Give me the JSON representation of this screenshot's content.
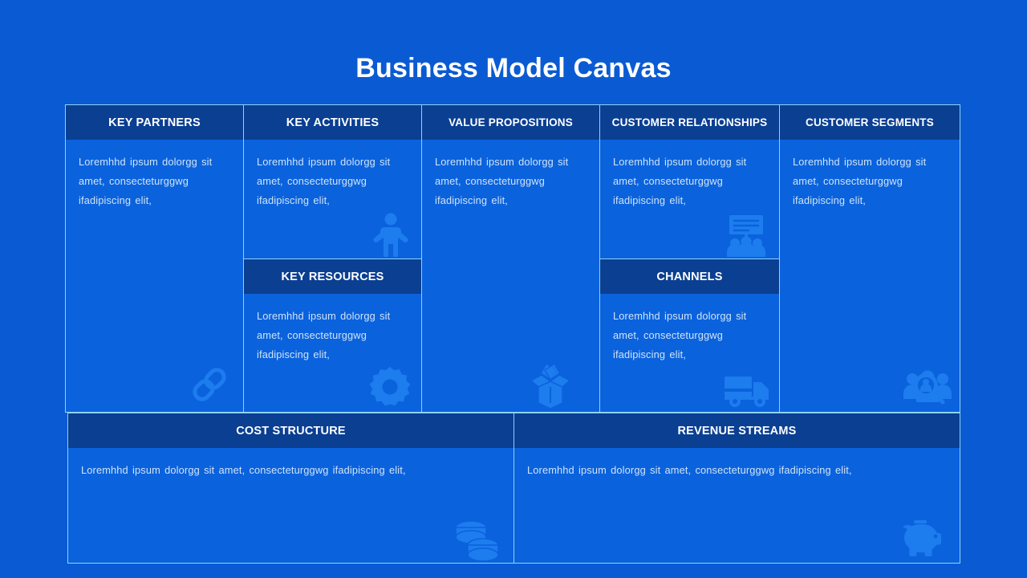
{
  "page": {
    "title": "Business Model Canvas",
    "background_color": "#0a5bd3",
    "panel_color": "#0b62dd",
    "header_color": "#0a3f92",
    "border_color": "#8fd3f4",
    "text_color": "#cfe4f7",
    "icon_color": "#1f7ff0"
  },
  "canvas": {
    "body_text_short": "Loremhhd ipsum dolorgg sit amet, consecteturggwg ifadipiscing  elit,",
    "body_text_wide": "Loremhhd ipsum dolorgg sit amet, consecteturggwg ifadipiscing  elit,",
    "blocks": {
      "key_partners": {
        "title": "KEY PARTNERS",
        "text": "Loremhhd ipsum dolorgg sit amet, consecteturggwg ifadipiscing  elit,",
        "icon": "chain-link-icon"
      },
      "key_activities": {
        "title": "KEY ACTIVITIES",
        "text": "Loremhhd ipsum dolorgg sit amet, consecteturggwg ifadipiscing  elit,",
        "icon": "person-icon"
      },
      "key_resources": {
        "title": "KEY RESOURCES",
        "text": "Loremhhd ipsum dolorgg sit amet, consecteturggwg ifadipiscing  elit,",
        "icon": "gear-icon"
      },
      "value_propositions": {
        "title": "VALUE PROPOSITIONS",
        "text": "Loremhhd ipsum dolorgg sit amet, consecteturggwg ifadipiscing  elit,",
        "icon": "open-box-icon"
      },
      "customer_relationships": {
        "title": "CUSTOMER RELATIONSHIPS",
        "text": "Loremhhd ipsum dolorgg sit amet, consecteturggwg ifadipiscing  elit,",
        "icon": "audience-presentation-icon"
      },
      "channels": {
        "title": "CHANNELS",
        "text": "Loremhhd ipsum dolorgg sit amet, consecteturggwg ifadipiscing  elit,",
        "icon": "delivery-truck-icon"
      },
      "customer_segments": {
        "title": "CUSTOMER SEGMENTS",
        "text": "Loremhhd ipsum dolorgg sit amet, consecteturggwg ifadipiscing  elit,",
        "icon": "customer-search-icon"
      },
      "cost_structure": {
        "title": "COST STRUCTURE",
        "text": "Loremhhd ipsum dolorgg sit amet, consecteturggwg ifadipiscing  elit,",
        "icon": "coins-icon"
      },
      "revenue_streams": {
        "title": "REVENUE STREAMS",
        "text": "Loremhhd ipsum dolorgg sit amet, consecteturggwg ifadipiscing  elit,",
        "icon": "piggy-bank-icon"
      }
    }
  }
}
